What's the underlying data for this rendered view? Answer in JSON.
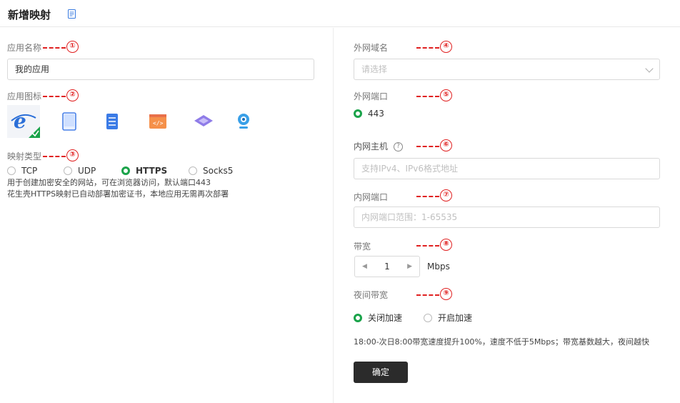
{
  "header": {
    "title": "新增映射"
  },
  "left": {
    "app_name": {
      "label": "应用名称",
      "anno": "①",
      "value": "我的应用"
    },
    "app_icon": {
      "label": "应用图标",
      "anno": "②"
    },
    "map_type": {
      "label": "映射类型",
      "anno": "③",
      "options": [
        "TCP",
        "UDP",
        "HTTPS",
        "Socks5"
      ],
      "selected": "HTTPS",
      "desc1": "用于创建加密安全的网站，可在浏览器访问，默认端口443",
      "desc2": "花生壳HTTPS映射已自动部署加密证书，本地应用无需再次部署"
    }
  },
  "right": {
    "domain": {
      "label": "外网域名",
      "anno": "④",
      "placeholder": "请选择"
    },
    "ext_port": {
      "label": "外网端口",
      "anno": "⑤",
      "value": "443"
    },
    "host": {
      "label": "内网主机",
      "anno": "⑥",
      "placeholder": "支持IPv4、IPv6格式地址"
    },
    "int_port": {
      "label": "内网端口",
      "anno": "⑦",
      "placeholder": "内网端口范围：1-65535"
    },
    "bandwidth": {
      "label": "带宽",
      "anno": "⑧",
      "value": "1",
      "unit": "Mbps"
    },
    "night": {
      "label": "夜间带宽",
      "anno": "⑨",
      "options": [
        "关闭加速",
        "开启加速"
      ],
      "selected": "关闭加速",
      "desc": "18:00-次日8:00带宽速度提升100%，速度不低于5Mbps；带宽基数越大，夜间越快"
    },
    "confirm_label": "确定"
  },
  "icons": [
    "ie-browser-icon",
    "tablet-icon",
    "server-icon",
    "code-icon",
    "cube-icon",
    "webcam-icon"
  ],
  "colors": {
    "accent": "#1aa34a",
    "annotation": "#e02020",
    "button": "#2b2b2b"
  }
}
